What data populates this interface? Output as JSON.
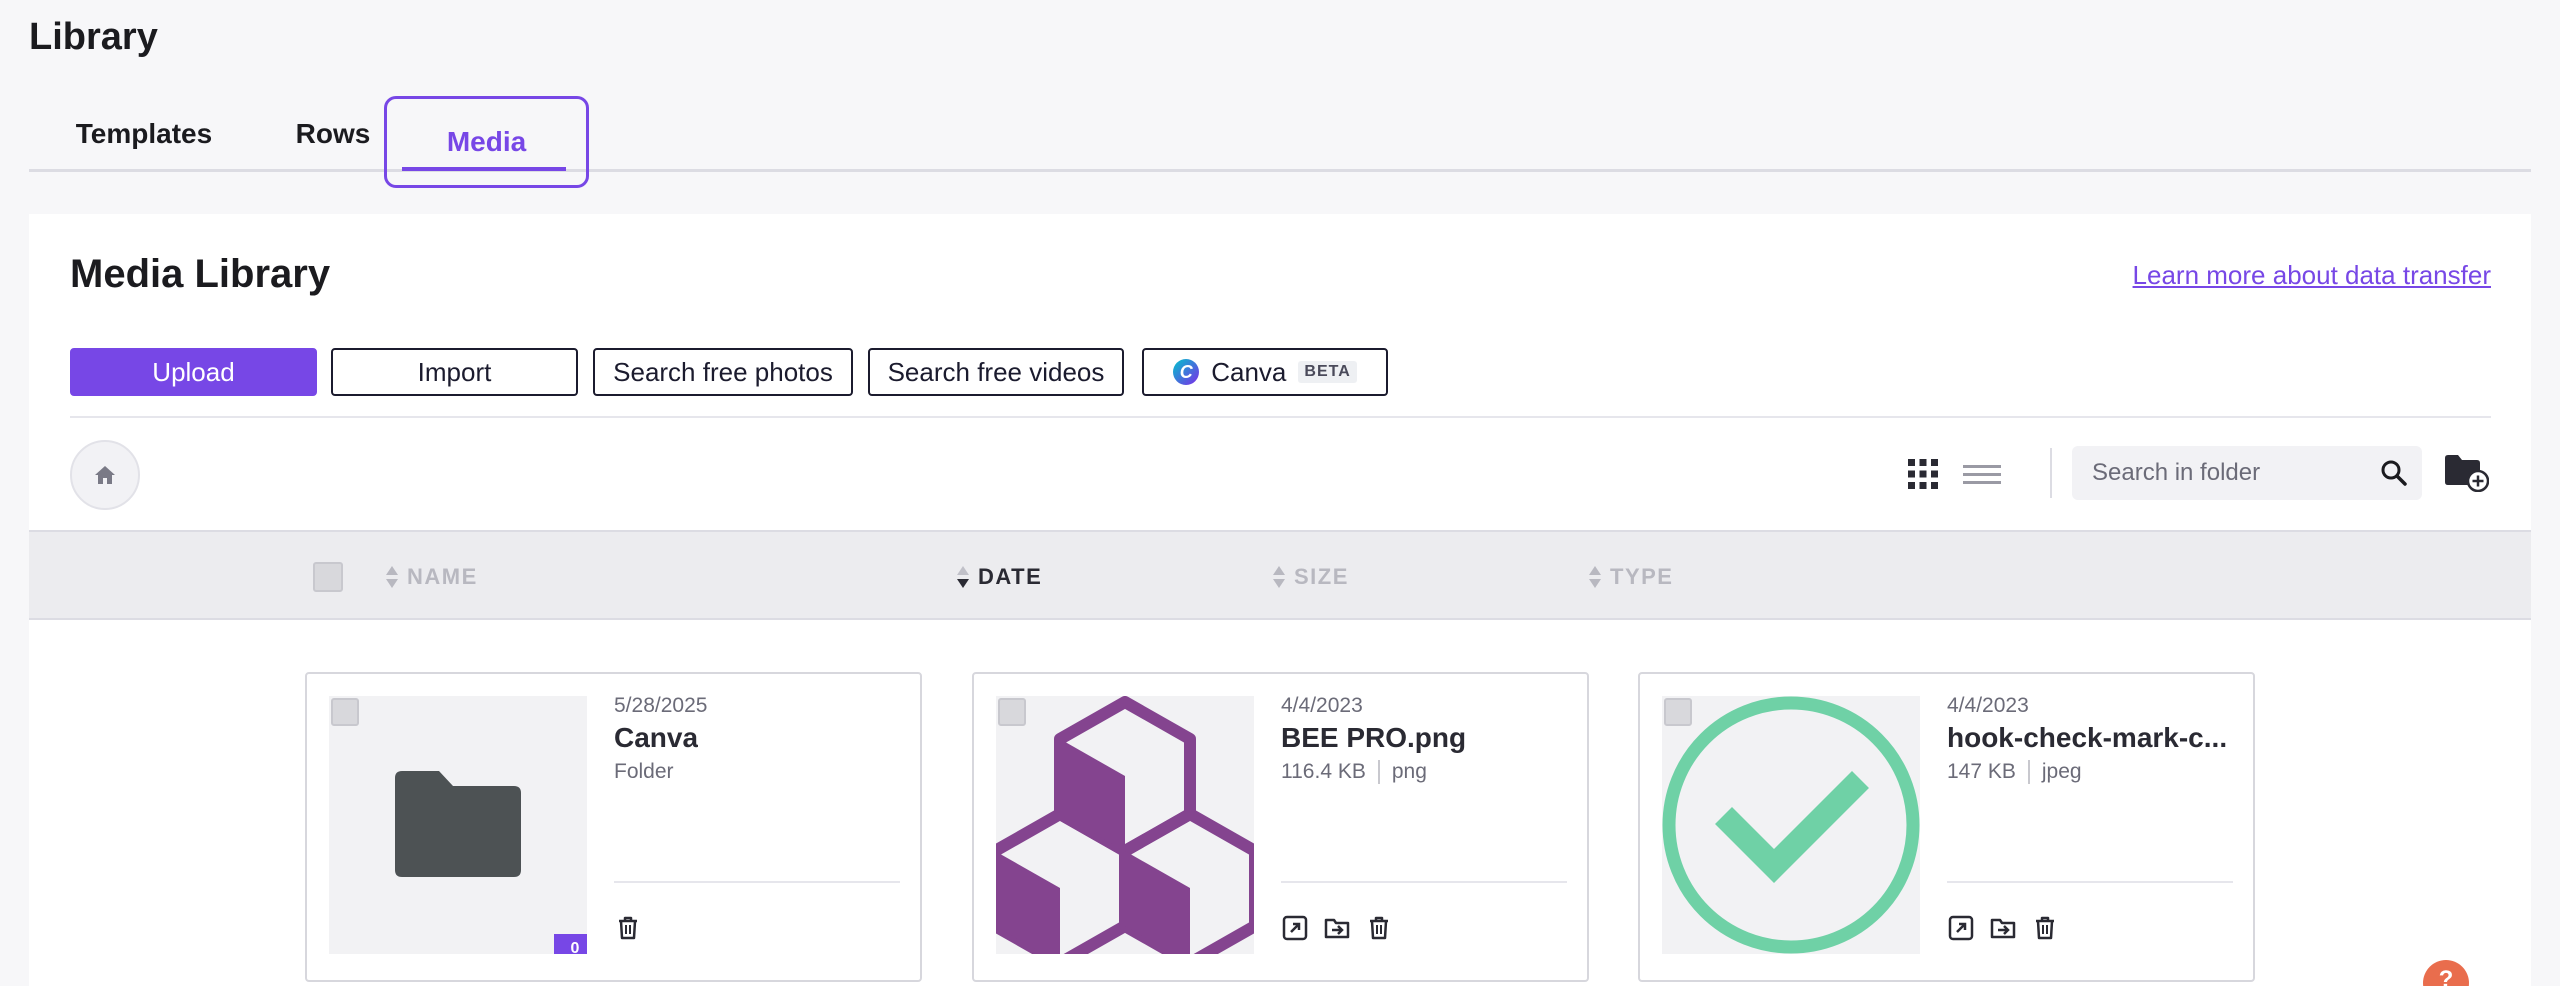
{
  "page": {
    "title": "Library"
  },
  "tabs": [
    {
      "label": "Templates"
    },
    {
      "label": "Rows"
    },
    {
      "label": "Media"
    }
  ],
  "media_library": {
    "title": "Media Library",
    "learn_link": "Learn more about data transfer",
    "buttons": {
      "upload": "Upload",
      "import": "Import",
      "search_photos": "Search free photos",
      "search_videos": "Search free videos",
      "canva": "Canva",
      "canva_badge": "BETA"
    },
    "search": {
      "placeholder": "Search in folder"
    },
    "columns": {
      "name": "NAME",
      "date": "DATE",
      "size": "SIZE",
      "type": "TYPE"
    },
    "items": [
      {
        "date": "5/28/2025",
        "name": "Canva",
        "kind": "Folder",
        "count": "0",
        "thumbnail_icon": "folder-icon"
      },
      {
        "date": "4/4/2023",
        "name": "BEE PRO.png",
        "size": "116.4 KB",
        "type": "png",
        "thumbnail_icon": "bee-pro-cubes-logo"
      },
      {
        "date": "4/4/2023",
        "name": "hook-check-mark-c...",
        "size": "147 KB",
        "type": "jpeg",
        "thumbnail_icon": "check-mark-circle"
      }
    ]
  },
  "help": {
    "label": "?"
  },
  "colors": {
    "accent": "#7747e6",
    "bee_purple": "#84448f",
    "check_green": "#6fd1a6",
    "folder_gray": "#4d5254",
    "help_orange": "#e96d4d"
  }
}
